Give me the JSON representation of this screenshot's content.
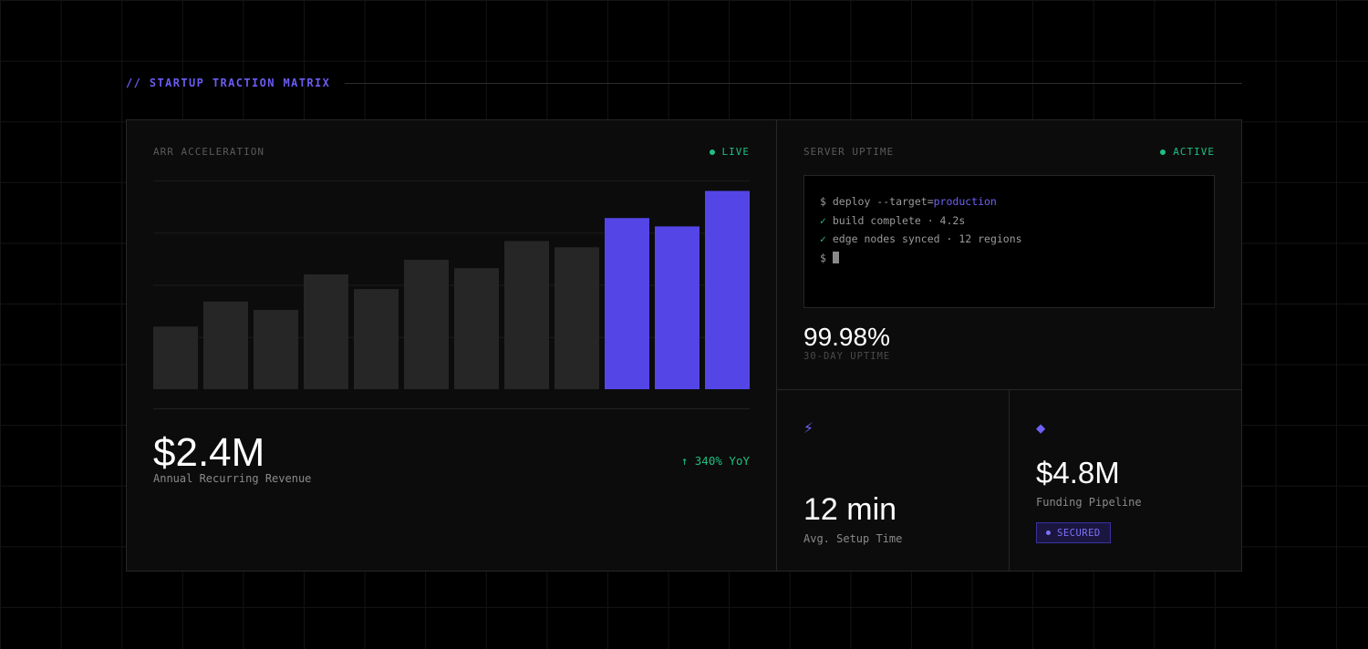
{
  "header": {
    "label": "// STARTUP TRACTION MATRIX"
  },
  "arr": {
    "title": "ARR ACCELERATION",
    "status": "LIVE",
    "value": "$2.4M",
    "label": "Annual Recurring Revenue",
    "growth": "↑ 340% YoY"
  },
  "uptime": {
    "title": "SERVER UPTIME",
    "status": "ACTIVE",
    "terminal": {
      "line1_prefix": "$ deploy --target=",
      "line1_target": "production",
      "line2_check": "✓",
      "line2_text": " build complete · 4.2s",
      "line3_check": "✓",
      "line3_text": " edge nodes synced · 12 regions",
      "line4_prompt": "$ "
    },
    "value": "99.98%",
    "caption": "30-DAY UPTIME"
  },
  "setup": {
    "icon": "lightning-icon",
    "value": "12 min",
    "label": "Avg. Setup Time"
  },
  "funding": {
    "icon": "diamond-icon",
    "value": "$4.8M",
    "label": "Funding Pipeline",
    "badge": "SECURED"
  },
  "colors": {
    "accent": "#5446e6",
    "bar_muted": "#262626",
    "success": "#1fbf82",
    "background": "#000000",
    "panel": "#0c0c0c"
  },
  "chart_data": {
    "type": "bar",
    "categories": [],
    "values": [
      30,
      42,
      38,
      55,
      48,
      62,
      58,
      71,
      68,
      82,
      78,
      95
    ],
    "highlighted_from_index": 9,
    "ylim": [
      0,
      100
    ],
    "grid": true,
    "xlabel": "",
    "ylabel": "",
    "title": ""
  }
}
